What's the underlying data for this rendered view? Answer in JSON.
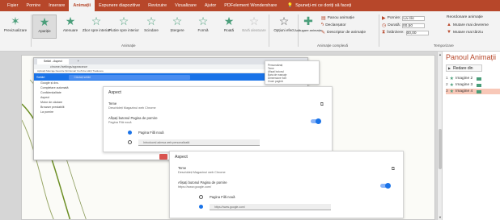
{
  "menu": {
    "tabs": [
      {
        "label": "Fișier",
        "active": false
      },
      {
        "label": "Pornire",
        "active": false
      },
      {
        "label": "Inserare",
        "active": false
      },
      {
        "label": "Animații",
        "active": true
      },
      {
        "label": "Expunere diapozitive",
        "active": false
      },
      {
        "label": "Revizuire",
        "active": false
      },
      {
        "label": "Vizualizare",
        "active": false
      },
      {
        "label": "Ajutor",
        "active": false
      },
      {
        "label": "PDFelement Wondershare",
        "active": false
      }
    ],
    "search_label": "Spuneți-mi ce doriți să faceți"
  },
  "ribbon": {
    "preview_label": "Previzualizare",
    "effects": [
      {
        "label": "Apariție",
        "selected": true,
        "disabled": false
      },
      {
        "label": "Atenuare",
        "selected": false,
        "disabled": false
      },
      {
        "label": "Zbor spre interior",
        "selected": false,
        "disabled": false
      },
      {
        "label": "Plutire spre interior",
        "selected": false,
        "disabled": false
      },
      {
        "label": "Scindare",
        "selected": false,
        "disabled": false
      },
      {
        "label": "Ștergere",
        "selected": false,
        "disabled": false
      },
      {
        "label": "Formă",
        "selected": false,
        "disabled": false
      },
      {
        "label": "Roată",
        "selected": false,
        "disabled": false
      },
      {
        "label": "Bară aleatoare",
        "selected": false,
        "disabled": true
      }
    ],
    "group_animation": "Animație",
    "effect_options": "Opțiuni efect",
    "add_animation": "Adăugare animație",
    "animation_pane_btn": "Panou animație",
    "trigger": "Declanșator",
    "painter": "Descriptor de animație",
    "group_advanced": "Animație complexă",
    "start_label": "Pornire:",
    "start_value": "La clic",
    "duration_label": "Durată:",
    "duration_value": "00,50",
    "delay_label": "Întârziere:",
    "delay_value": "00,00",
    "reorder": "Reordonare animație",
    "move_earlier": "Mutare mai devreme",
    "move_later": "Mutare mai târziu",
    "group_timing": "Temporizare"
  },
  "slide": {
    "browser": {
      "tab1": "Setări - Aspect",
      "tab2": "+",
      "address": "chrome://settings/appearance",
      "bookmarks": "Aplicații   Marcaje   Favorite   Știri   Email   YouTube   Hărți   Traducere",
      "brand": "Setări",
      "search_placeholder": "Căutați setări",
      "sidebar": [
        "Google și dvs.",
        "Completare automată",
        "Confidențialitate",
        "Aspect",
        "Motor de căutare",
        "Browser prestabilit",
        "La pornire"
      ]
    },
    "popup_lines": [
      "Personalizați",
      "Teme",
      "Afișați butonul",
      "Bara de marcaje",
      "Dimensiune font",
      "Zoom pagină"
    ],
    "card1": {
      "title": "Aspect",
      "teme": "Teme",
      "theme_value": "Deschideți Magazinul web Chrome",
      "home_title": "Afișați butonul Pagina de pornire",
      "home_sub": "Pagina Filă nouă",
      "opt1": "Pagina Filă nouă",
      "opt2": "Introduceți adresa web personalizată"
    },
    "card2": {
      "title": "Aspect",
      "teme": "Teme",
      "theme_value": "Deschideți Magazinul web Chrome",
      "home_title": "Afișați butonul Pagina de pornire",
      "home_sub": "https://www.google.com/",
      "opt1": "Pagina Filă nouă",
      "opt2": "https://www.google.com/"
    }
  },
  "anim_pane": {
    "title": "Panoul Animații",
    "play": "Redare din",
    "items": [
      {
        "num": "1",
        "label": "Imagine 2",
        "selected": false
      },
      {
        "num": "2",
        "label": "Imagine 3",
        "selected": false
      },
      {
        "num": "3",
        "label": "Imagine 4",
        "selected": true
      }
    ]
  },
  "colors": {
    "accent": "#b7472a",
    "effect_star": "#4a9e7a",
    "chrome_blue": "#1a73e8"
  }
}
